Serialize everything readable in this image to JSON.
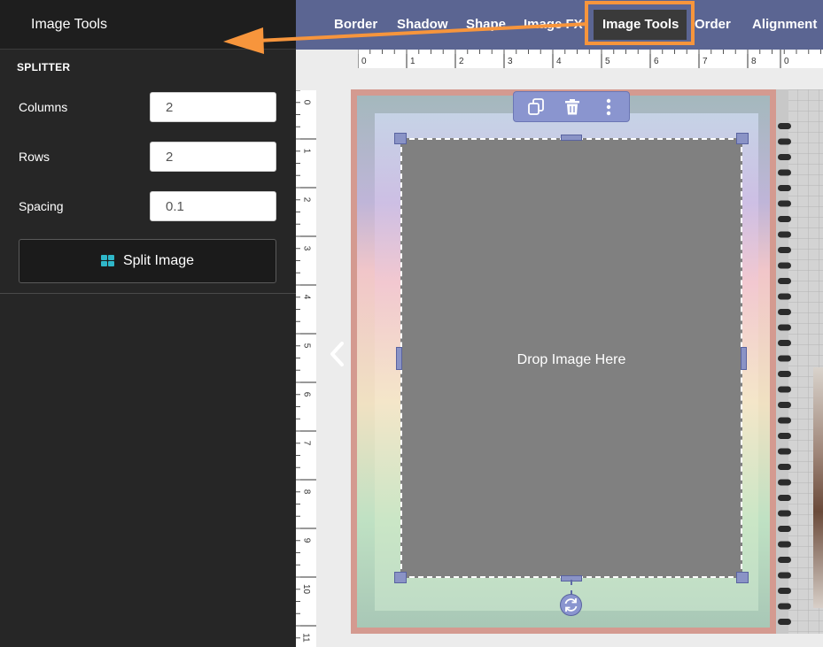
{
  "sidebar": {
    "title": "Image Tools",
    "section": "SPLITTER",
    "fields": {
      "columns": {
        "label": "Columns",
        "value": "2"
      },
      "rows": {
        "label": "Rows",
        "value": "2"
      },
      "spacing": {
        "label": "Spacing",
        "value": "0.1"
      }
    },
    "split_button": {
      "label": "Split Image",
      "icon": "grid-icon"
    }
  },
  "toolbar": {
    "items": [
      "Border",
      "Shadow",
      "Shape",
      "Image FX",
      "Image Tools",
      "Order",
      "Alignment"
    ],
    "active": "Image Tools",
    "highlight_color": "#f7953c"
  },
  "rulers": {
    "top": [
      "0",
      "1",
      "2",
      "3",
      "4",
      "5",
      "6",
      "7",
      "8",
      "0"
    ],
    "left": [
      "0",
      "1",
      "2",
      "3",
      "4",
      "5",
      "6",
      "7",
      "8",
      "9",
      "10",
      "11"
    ]
  },
  "canvas": {
    "placeholder_text": "Drop Image Here",
    "float_toolbar": [
      "duplicate-icon",
      "trash-icon",
      "more-vertical-icon"
    ],
    "rotate_icon": "rotate-icon",
    "prev_icon": "chevron-left-icon"
  },
  "colors": {
    "toolbar_bg": "#5b6592",
    "panel_bg": "#262626",
    "accent": "#2fb7c9",
    "annotation_arrow": "#f7953c"
  }
}
